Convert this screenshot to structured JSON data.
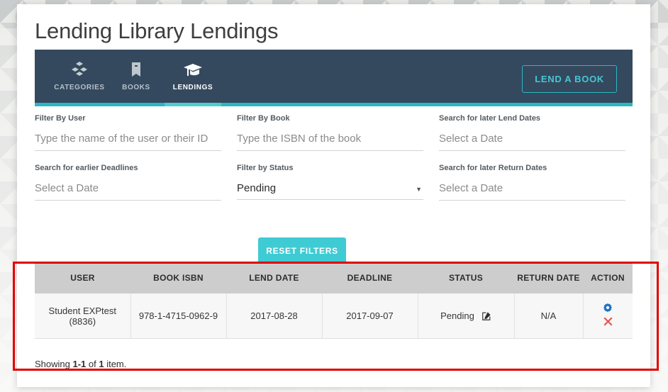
{
  "page_title": "Lending Library Lendings",
  "nav": {
    "tabs": [
      {
        "label": "CATEGORIES",
        "icon": "cubes-icon",
        "active": false
      },
      {
        "label": "BOOKS",
        "icon": "book-icon",
        "active": false
      },
      {
        "label": "LENDINGS",
        "icon": "graduation-cap-icon",
        "active": true
      }
    ],
    "lend_a_book_label": "LEND A BOOK"
  },
  "filters": {
    "user": {
      "label": "Filter By User",
      "placeholder": "Type the name of the user or their ID",
      "value": ""
    },
    "book": {
      "label": "Filter By Book",
      "placeholder": "Type the ISBN of the book",
      "value": ""
    },
    "lend_dates": {
      "label": "Search for later Lend Dates",
      "placeholder": "Select a Date",
      "value": ""
    },
    "deadlines": {
      "label": "Search for earlier Deadlines",
      "placeholder": "Select a Date",
      "value": ""
    },
    "status": {
      "label": "Filter by Status",
      "value": "Pending",
      "caret": "▼"
    },
    "return_dates": {
      "label": "Search for later Return Dates",
      "placeholder": "Select a Date",
      "value": ""
    },
    "reset_label": "RESET FILTERS"
  },
  "table": {
    "headers": [
      "USER",
      "BOOK ISBN",
      "LEND DATE",
      "DEADLINE",
      "STATUS",
      "RETURN DATE",
      "ACTION"
    ],
    "rows": [
      {
        "user": "Student EXPtest (8836)",
        "isbn": "978-1-4715-0962-9",
        "lend_date": "2017-08-28",
        "deadline": "2017-09-07",
        "status": "Pending",
        "return_date": "N/A"
      }
    ]
  },
  "footer": {
    "showing_prefix": "Showing ",
    "range": "1-1",
    "showing_mid": " of ",
    "count": "1",
    "showing_suffix": " item."
  },
  "colors": {
    "navbar": "#34495e",
    "accent_teal": "#2ab7c4",
    "reset_button": "#3fcbd4",
    "table_header": "#cdcdcd",
    "highlight_red": "#e00000",
    "gear_blue": "#1d72c2",
    "delete_red": "#e2534c"
  }
}
